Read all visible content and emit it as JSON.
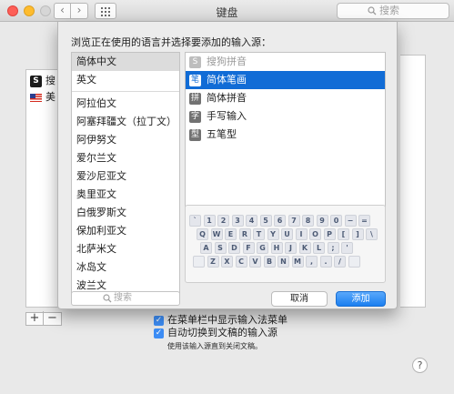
{
  "window": {
    "title": "键盘",
    "search_placeholder": "搜索",
    "nav_back": "‹",
    "nav_forward": "›"
  },
  "background": {
    "sources": [
      "搜",
      "美"
    ],
    "source_badge": "S",
    "add_button": "+",
    "remove_button": "−",
    "checkbox_1": "在菜单栏中显示输入法菜单",
    "checkbox_2": "自动切换到文稿的输入源",
    "hint": "使用该输入源直到关闭文稿。",
    "help": "?"
  },
  "sheet": {
    "title": "浏览正在使用的语言并选择要添加的输入源：",
    "languages": [
      "简体中文",
      "英文",
      "阿拉伯文",
      "阿塞拜疆文（拉丁文）",
      "阿伊努文",
      "爱尔兰文",
      "爱沙尼亚文",
      "奥里亚文",
      "白俄罗斯文",
      "保加利亚文",
      "北萨米文",
      "冰岛文",
      "波兰文"
    ],
    "sources": [
      {
        "icon": "S",
        "label": "搜狗拼音",
        "state": "disabled"
      },
      {
        "icon": "笔",
        "label": "简体笔画",
        "state": "selected"
      },
      {
        "icon": "拼",
        "label": "简体拼音",
        "state": "normal"
      },
      {
        "icon": "字",
        "label": "手写输入",
        "state": "normal"
      },
      {
        "icon": "型",
        "label": "五笔型",
        "state": "normal"
      }
    ],
    "keyboard": {
      "row1": [
        "`",
        "1",
        "2",
        "3",
        "4",
        "5",
        "6",
        "7",
        "8",
        "9",
        "0",
        "−",
        "="
      ],
      "row2": [
        "Q",
        "W",
        "E",
        "R",
        "T",
        "Y",
        "U",
        "I",
        "O",
        "P",
        "[",
        "]",
        "\\"
      ],
      "row3": [
        "A",
        "S",
        "D",
        "F",
        "G",
        "H",
        "J",
        "K",
        "L",
        ";",
        "'"
      ],
      "row4": [
        "Z",
        "X",
        "C",
        "V",
        "B",
        "N",
        "M",
        ",",
        ".",
        "/"
      ]
    },
    "search_placeholder": "搜索",
    "cancel_label": "取消",
    "add_label": "添加"
  },
  "colors": {
    "accent": "#116cd6",
    "traffic_red": "#fd5f57",
    "traffic_yellow": "#febc2e"
  }
}
